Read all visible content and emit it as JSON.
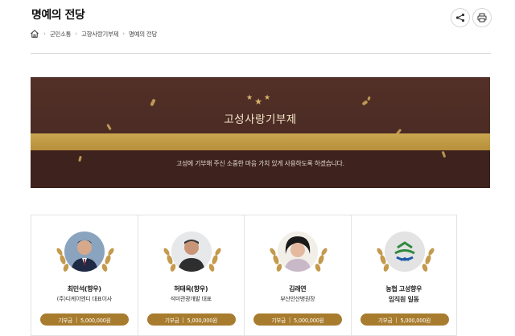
{
  "page": {
    "title": "명예의 전당"
  },
  "toolbar": {
    "share_icon": "share-icon",
    "print_icon": "print-icon"
  },
  "breadcrumb": {
    "home_icon": "home-icon",
    "items": [
      "군민소통",
      "고향사랑기부제",
      "명예의 전당"
    ]
  },
  "banner": {
    "title": "고성사랑기부제",
    "description": "고성에 기부해 주신 소중한 마음 가치 있게 사용하도록 하겠습니다.",
    "colors": {
      "dark": "#4a2b25",
      "gold": "#c9a64f"
    }
  },
  "donors": [
    {
      "name": "최민석(향우)",
      "role": "(주)디케이엔디 대표이사",
      "amount_label": "기부금",
      "amount": "5,000,000원",
      "photo": "man-suit-photo"
    },
    {
      "name": "허태옥(향우)",
      "role": "석미관광개발 대표",
      "amount_label": "기부금",
      "amount": "5,000,000원",
      "photo": "man-photo"
    },
    {
      "name": "김래연",
      "role": "부산안산병원장",
      "amount_label": "기부금",
      "amount": "5,000,000원",
      "photo": "woman-photo"
    },
    {
      "name": "농협 고성향우",
      "role": "임직원 일동",
      "amount_label": "기부금",
      "amount": "5,000,000원",
      "photo": "nonghyup-logo"
    }
  ],
  "accent_color": "#a87c2e"
}
